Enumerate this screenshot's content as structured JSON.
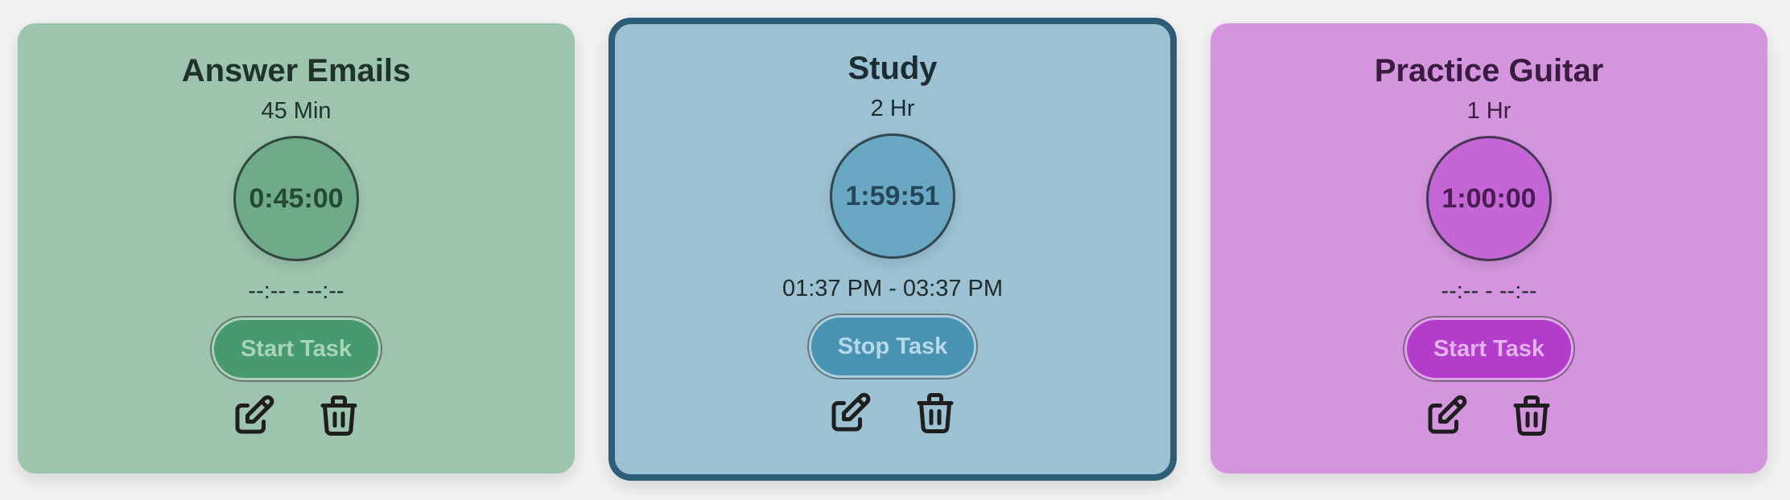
{
  "tasks": [
    {
      "title": "Answer Emails",
      "duration": "45 Min",
      "timer": "0:45:00",
      "range": "--:-- - --:--",
      "button": "Start Task",
      "icons": [
        "edit-icon",
        "trash-icon"
      ],
      "colors": {
        "card": "#9cc4ae",
        "clock": "#6fab89",
        "button": "#469a6d",
        "buttonText": "#a8d4b9",
        "text": "#1f3329",
        "clockText": "#244a36"
      }
    },
    {
      "title": "Study",
      "duration": "2 Hr",
      "timer": "1:59:51",
      "range": "01:37 PM - 03:37 PM",
      "button": "Stop Task",
      "active": true,
      "icons": [
        "edit-icon",
        "trash-icon"
      ],
      "colors": {
        "card": "#9bc1d3",
        "clock": "#6aa7c2",
        "button": "#4a92b2",
        "buttonText": "#b5d9ea",
        "text": "#1c2c33",
        "clockText": "#24475a",
        "border": "#2e5e77"
      }
    },
    {
      "title": "Practice Guitar",
      "duration": "1 Hr",
      "timer": "1:00:00",
      "range": "--:-- - --:--",
      "button": "Start Task",
      "icons": [
        "edit-icon",
        "trash-icon"
      ],
      "colors": {
        "card": "#d495de",
        "clock": "#c466d6",
        "button": "#b43ccb",
        "buttonText": "#e2b3ea",
        "text": "#3a1c40",
        "clockText": "#4a1c54"
      }
    }
  ]
}
